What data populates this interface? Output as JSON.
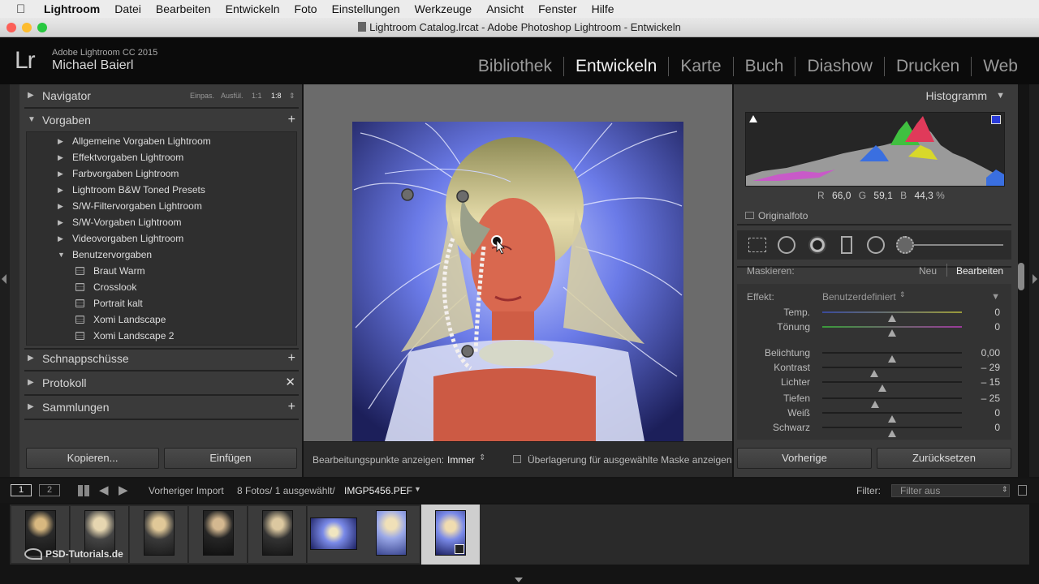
{
  "menubar": {
    "app": "Lightroom",
    "items": [
      "Datei",
      "Bearbeiten",
      "Entwickeln",
      "Foto",
      "Einstellungen",
      "Werkzeuge",
      "Ansicht",
      "Fenster",
      "Hilfe"
    ]
  },
  "window": {
    "title": "Lightroom Catalog.lrcat - Adobe Photoshop Lightroom - Entwickeln"
  },
  "identity": {
    "logo": "Lr",
    "app_name": "Adobe Lightroom CC 2015",
    "user": "Michael Baierl"
  },
  "modules": [
    "Bibliothek",
    "Entwickeln",
    "Karte",
    "Buch",
    "Diashow",
    "Drucken",
    "Web"
  ],
  "left_panel": {
    "navigator": {
      "title": "Navigator",
      "zoom": [
        "Einpas.",
        "Ausfül.",
        "1:1",
        "1:8"
      ]
    },
    "presets": {
      "title": "Vorgaben",
      "folders": [
        "Allgemeine Vorgaben Lightroom",
        "Effektvorgaben Lightroom",
        "Farbvorgaben Lightroom",
        "Lightroom B&W Toned Presets",
        "S/W-Filtervorgaben Lightroom",
        "S/W-Vorgaben Lightroom",
        "Videovorgaben Lightroom",
        "Benutzervorgaben"
      ],
      "user_presets": [
        "Braut Warm",
        "Crosslook",
        "Portrait kalt",
        "Xomi Landscape",
        "Xomi Landscape 2"
      ]
    },
    "snapshots": "Schnappschüsse",
    "history": "Protokoll",
    "collections": "Sammlungen",
    "copy_button": "Kopieren...",
    "paste_button": "Einfügen"
  },
  "toolbar": {
    "show_pins_label": "Bearbeitungspunkte anzeigen:",
    "show_pins_value": "Immer",
    "overlay_label": "Überlagerung für ausgewählte Maske anzeigen"
  },
  "right_panel": {
    "histogram": {
      "title": "Histogramm",
      "r_label": "R",
      "r_value": "66,0",
      "g_label": "G",
      "g_value": "59,1",
      "b_label": "B",
      "b_value": "44,3",
      "unit": "%",
      "original_photo": "Originalfoto"
    },
    "mask": {
      "label": "Maskieren:",
      "new": "Neu",
      "edit": "Bearbeiten"
    },
    "effect": {
      "label": "Effekt:",
      "value": "Benutzerdefiniert"
    },
    "sliders": [
      {
        "label": "Temp.",
        "value": "0",
        "pos": 0.5
      },
      {
        "label": "Tönung",
        "value": "0",
        "pos": 0.5
      },
      {
        "label": "Belichtung",
        "value": "0,00",
        "pos": 0.5
      },
      {
        "label": "Kontrast",
        "value": "– 29",
        "pos": 0.37
      },
      {
        "label": "Lichter",
        "value": "– 15",
        "pos": 0.43
      },
      {
        "label": "Tiefen",
        "value": "– 25",
        "pos": 0.38
      },
      {
        "label": "Weiß",
        "value": "0",
        "pos": 0.5
      },
      {
        "label": "Schwarz",
        "value": "0",
        "pos": 0.5
      }
    ],
    "prev_button": "Vorherige",
    "reset_button": "Zurücksetzen"
  },
  "filmstrip_bar": {
    "screen1": "1",
    "screen2": "2",
    "source": "Vorheriger Import",
    "count": "8 Fotos/ 1 ausgewählt/",
    "filename": "IMGP5456.PEF",
    "filter_label": "Filter:",
    "filter_value": "Filter aus"
  },
  "watermark": "PSD-Tutorials.de",
  "colors": {
    "accent_blue": "#2a3bd8",
    "panel": "#3a3a3a",
    "background": "#141414"
  }
}
